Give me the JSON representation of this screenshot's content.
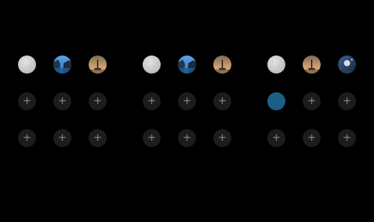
{
  "icons": {
    "add": "plus-icon"
  },
  "panels": [
    {
      "rows": [
        [
          {
            "type": "photo",
            "image": "gray-texture"
          },
          {
            "type": "photo",
            "image": "coastal-cliff"
          },
          {
            "type": "photo",
            "image": "sunset-landmark"
          }
        ],
        [
          {
            "type": "empty",
            "label": "+"
          },
          {
            "type": "empty",
            "label": "+"
          },
          {
            "type": "empty",
            "label": "+"
          }
        ],
        [
          {
            "type": "empty",
            "label": "+"
          },
          {
            "type": "empty",
            "label": "+"
          },
          {
            "type": "empty",
            "label": "+"
          }
        ]
      ]
    },
    {
      "rows": [
        [
          {
            "type": "photo",
            "image": "gray-texture"
          },
          {
            "type": "photo",
            "image": "coastal-cliff"
          },
          {
            "type": "photo",
            "image": "sunset-landmark"
          }
        ],
        [
          {
            "type": "empty",
            "label": "+"
          },
          {
            "type": "empty",
            "label": "+"
          },
          {
            "type": "empty",
            "label": "+"
          }
        ],
        [
          {
            "type": "empty",
            "label": "+"
          },
          {
            "type": "empty",
            "label": "+"
          },
          {
            "type": "empty",
            "label": "+"
          }
        ]
      ]
    },
    {
      "rows": [
        [
          {
            "type": "photo",
            "image": "gray-texture"
          },
          {
            "type": "photo",
            "image": "sunset-landmark"
          },
          {
            "type": "photo",
            "image": "night-portrait"
          }
        ],
        [
          {
            "type": "selected",
            "color": "#1b5f86"
          },
          {
            "type": "empty",
            "label": "+"
          },
          {
            "type": "empty",
            "label": "+"
          }
        ],
        [
          {
            "type": "empty",
            "label": "+"
          },
          {
            "type": "empty",
            "label": "+"
          },
          {
            "type": "empty",
            "label": "+"
          }
        ]
      ]
    }
  ]
}
